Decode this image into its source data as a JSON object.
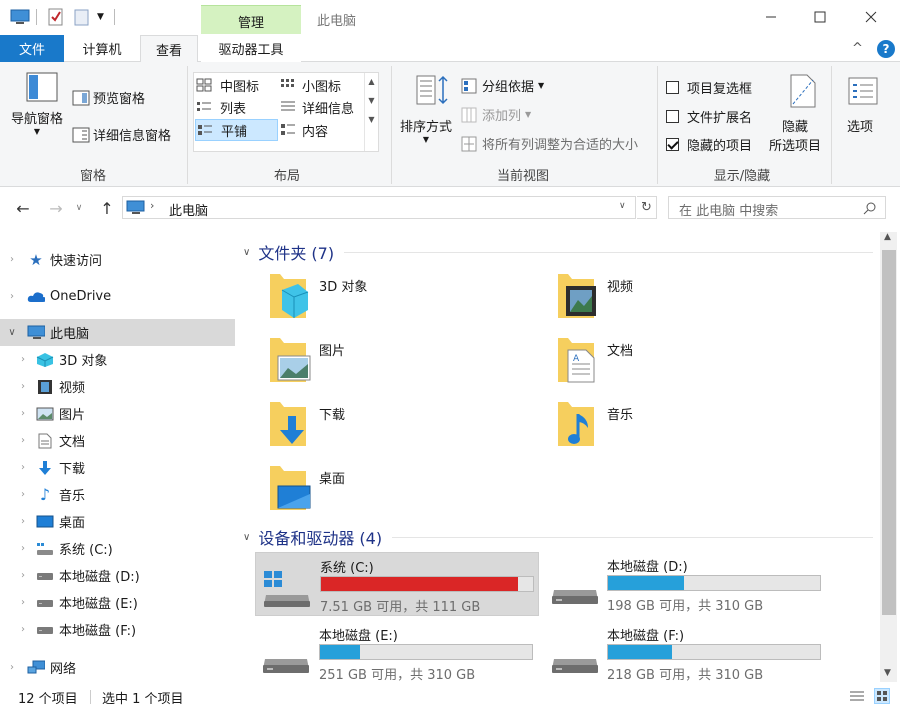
{
  "window": {
    "title": "此电脑",
    "context_group": "管理",
    "controls": {
      "minimize": "—",
      "maximize": "☐",
      "close": "✕"
    }
  },
  "tabs": {
    "file": "文件",
    "computer": "计算机",
    "view": "查看",
    "drive_tools": "驱动器工具"
  },
  "ribbon": {
    "panes": {
      "label": "窗格",
      "nav_pane": "导航窗格",
      "preview_pane": "预览窗格",
      "details_pane": "详细信息窗格"
    },
    "layout": {
      "label": "布局",
      "options": [
        "中图标",
        "小图标",
        "列表",
        "详细信息",
        "平铺",
        "内容"
      ],
      "selected": "平铺"
    },
    "current_view": {
      "label": "当前视图",
      "sort_by": "排序方式",
      "group_by": "分组依据",
      "add_columns": "添加列",
      "fit_columns": "将所有列调整为合适的大小"
    },
    "show_hide": {
      "label": "显示/隐藏",
      "item_checkboxes": "项目复选框",
      "file_extensions": "文件扩展名",
      "hidden_items": "隐藏的项目",
      "hide_selected_line1": "隐藏",
      "hide_selected_line2": "所选项目",
      "item_checkboxes_checked": false,
      "file_extensions_checked": false,
      "hidden_items_checked": true
    },
    "options": "选项"
  },
  "address": {
    "path": "此电脑",
    "search_placeholder": "在 此电脑 中搜索"
  },
  "nav": {
    "items": [
      {
        "label": "快速访问",
        "icon": "star-icon"
      },
      {
        "label": "OneDrive",
        "icon": "cloud-icon"
      },
      {
        "label": "此电脑",
        "icon": "computer-icon"
      },
      {
        "label": "3D 对象",
        "icon": "cube-icon"
      },
      {
        "label": "视频",
        "icon": "video-icon"
      },
      {
        "label": "图片",
        "icon": "picture-icon"
      },
      {
        "label": "文档",
        "icon": "document-icon"
      },
      {
        "label": "下载",
        "icon": "download-icon"
      },
      {
        "label": "音乐",
        "icon": "music-icon"
      },
      {
        "label": "桌面",
        "icon": "desktop-icon"
      },
      {
        "label": "系统 (C:)",
        "icon": "system-drive-icon"
      },
      {
        "label": "本地磁盘 (D:)",
        "icon": "drive-icon"
      },
      {
        "label": "本地磁盘 (E:)",
        "icon": "drive-icon"
      },
      {
        "label": "本地磁盘 (F:)",
        "icon": "drive-icon"
      },
      {
        "label": "网络",
        "icon": "network-icon"
      }
    ]
  },
  "folders": {
    "header": "文件夹 (7)",
    "items": [
      "3D 对象",
      "视频",
      "图片",
      "文档",
      "下载",
      "音乐",
      "桌面"
    ]
  },
  "drives": {
    "header": "设备和驱动器 (4)",
    "items": [
      {
        "name": "系统 (C:)",
        "info": "7.51 GB 可用，共 111 GB",
        "used_fraction": 0.93,
        "color": "#da2626"
      },
      {
        "name": "本地磁盘 (D:)",
        "info": "198 GB 可用，共 310 GB",
        "used_fraction": 0.36,
        "color": "#26a0da"
      },
      {
        "name": "本地磁盘 (E:)",
        "info": "251 GB 可用，共 310 GB",
        "used_fraction": 0.19,
        "color": "#26a0da"
      },
      {
        "name": "本地磁盘 (F:)",
        "info": "218 GB 可用，共 310 GB",
        "used_fraction": 0.3,
        "color": "#26a0da"
      }
    ]
  },
  "status": {
    "count": "12 个项目",
    "selected": "选中 1 个项目"
  },
  "colors": {
    "accent": "#1979ca",
    "header_text": "#1e3287",
    "selection": "#cce8ff",
    "folder": "#f6cf5e"
  }
}
